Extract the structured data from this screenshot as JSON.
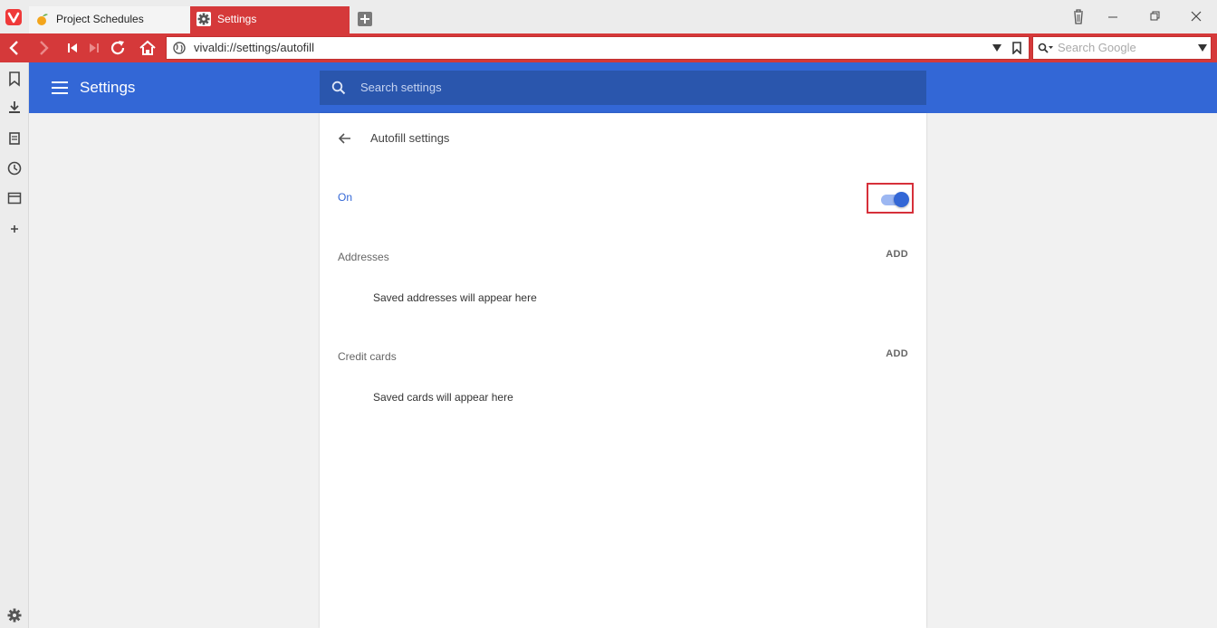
{
  "tabs": [
    {
      "title": "Project Schedules",
      "icon": "fruit-icon",
      "active": false
    },
    {
      "title": "Settings",
      "icon": "gear-icon",
      "active": true
    }
  ],
  "address_bar": {
    "url": "vivaldi://settings/autofill",
    "search_placeholder": "Search Google"
  },
  "settings_header": {
    "title": "Settings",
    "search_placeholder": "Search settings"
  },
  "autofill": {
    "title": "Autofill settings",
    "toggle_label": "On",
    "toggle_on": true,
    "addresses": {
      "label": "Addresses",
      "add_label": "ADD",
      "empty_text": "Saved addresses will appear here"
    },
    "credit_cards": {
      "label": "Credit cards",
      "add_label": "ADD",
      "empty_text": "Saved cards will appear here"
    }
  },
  "colors": {
    "browser_accent": "#d5393a",
    "settings_blue": "#3367d6"
  }
}
